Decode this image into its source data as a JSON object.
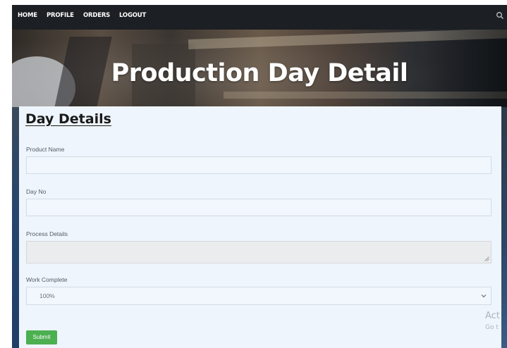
{
  "nav": {
    "items": [
      "HOME",
      "PROFILE",
      "ORDERS",
      "LOGOUT"
    ],
    "search_icon": "search-icon"
  },
  "hero": {
    "title": "Production Day Detail"
  },
  "form": {
    "section_title": "Day Details",
    "fields": {
      "product_name": {
        "label": "Product Name",
        "value": ""
      },
      "day_no": {
        "label": "Day No",
        "value": ""
      },
      "process_details": {
        "label": "Process Details",
        "value": ""
      },
      "work_complete": {
        "label": "Work Complete",
        "selected": "100%"
      }
    },
    "submit_label": "Submit"
  },
  "watermark": {
    "line1": "Act",
    "line2": "Go t"
  },
  "colors": {
    "navbar": "#1c1f23",
    "panel": "#eef5fc",
    "submit_button": "#4caf50",
    "title_text": "#ffffff"
  }
}
